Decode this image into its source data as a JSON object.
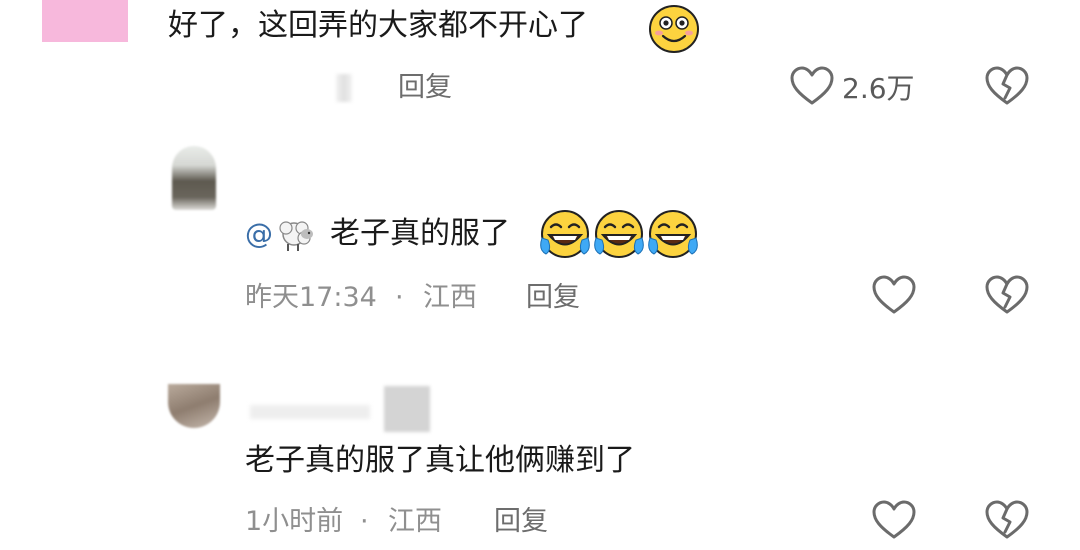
{
  "comments": [
    {
      "text": "好了，这回弄的大家都不开心了",
      "reply_label": "回复",
      "like_count": "2.6万"
    },
    {
      "mention": "@",
      "text": "老子真的服了",
      "time": "昨天17:34",
      "separator": "·",
      "location": "江西",
      "reply_label": "回复"
    },
    {
      "text": "老子真的服了真让他俩赚到了",
      "time": "1小时前",
      "separator": "·",
      "location": "江西",
      "reply_label": "回复"
    }
  ],
  "icons": {
    "like": "heart-outline-icon",
    "dislike": "broken-heart-icon",
    "emoji_smile": "blush-smile-emoji",
    "emoji_laugh": "laugh-crying-emoji",
    "emoji_sheep": "sheep-emoji"
  },
  "colors": {
    "text": "#1a1a1a",
    "meta": "#8f8f8f",
    "mention": "#3a6ea8",
    "icon_stroke": "#6b6b6b",
    "emoji_yellow": "#fcd33f"
  }
}
